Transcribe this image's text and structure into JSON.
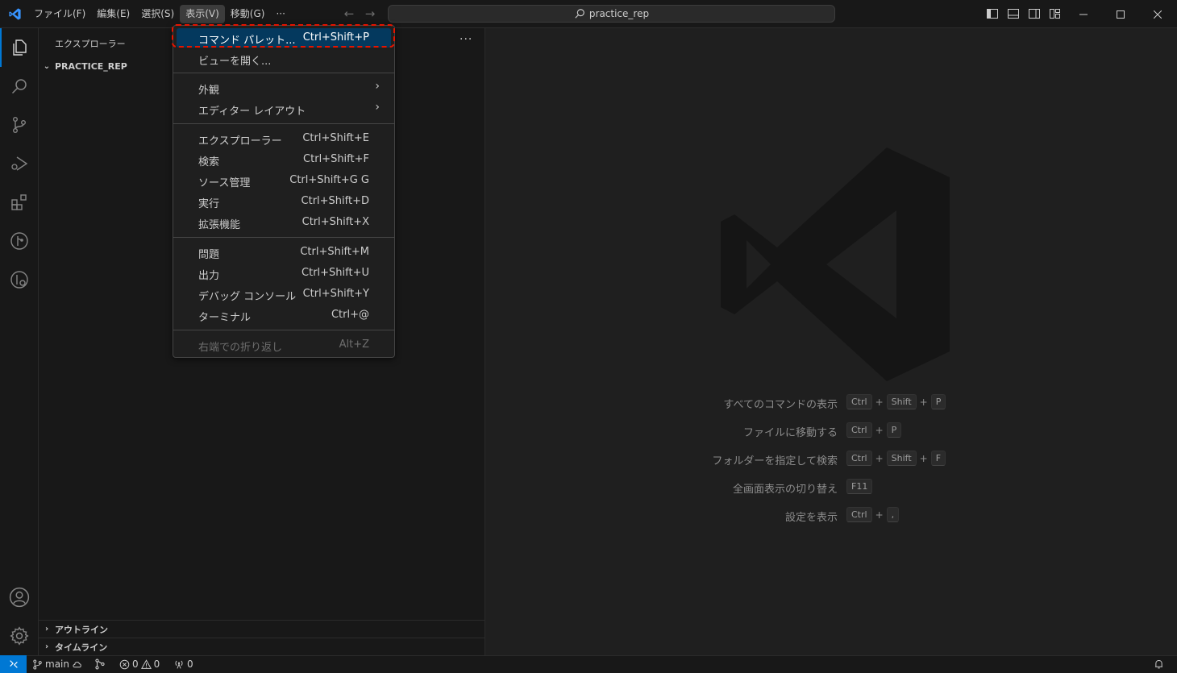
{
  "titlebar": {
    "menus": [
      "ファイル(F)",
      "編集(E)",
      "選択(S)",
      "表示(V)",
      "移動(G)",
      "···"
    ],
    "search_text": "practice_rep"
  },
  "sidebar": {
    "title": "エクスプローラー",
    "more": "···",
    "folder": "PRACTICE_REP",
    "outline": "アウトライン",
    "timeline": "タイムライン"
  },
  "dropdown": {
    "items": [
      {
        "label": "コマンド パレット...",
        "key": "Ctrl+Shift+P"
      },
      {
        "label": "ビューを開く...",
        "key": ""
      },
      {
        "label": "外観",
        "key": ""
      },
      {
        "label": "エディター レイアウト",
        "key": ""
      },
      {
        "label": "エクスプローラー",
        "key": "Ctrl+Shift+E"
      },
      {
        "label": "検索",
        "key": "Ctrl+Shift+F"
      },
      {
        "label": "ソース管理",
        "key": "Ctrl+Shift+G G"
      },
      {
        "label": "実行",
        "key": "Ctrl+Shift+D"
      },
      {
        "label": "拡張機能",
        "key": "Ctrl+Shift+X"
      },
      {
        "label": "問題",
        "key": "Ctrl+Shift+M"
      },
      {
        "label": "出力",
        "key": "Ctrl+Shift+U"
      },
      {
        "label": "デバッグ コンソール",
        "key": "Ctrl+Shift+Y"
      },
      {
        "label": "ターミナル",
        "key": "Ctrl+@"
      },
      {
        "label": "右端での折り返し",
        "key": "Alt+Z"
      }
    ],
    "submenu_arrow": "›"
  },
  "editor": {
    "shortcuts": [
      {
        "label": "すべてのコマンドの表示",
        "keys": [
          "Ctrl",
          "Shift",
          "P"
        ]
      },
      {
        "label": "ファイルに移動する",
        "keys": [
          "Ctrl",
          "P"
        ]
      },
      {
        "label": "フォルダーを指定して検索",
        "keys": [
          "Ctrl",
          "Shift",
          "F"
        ]
      },
      {
        "label": "全画面表示の切り替え",
        "keys": [
          "F11"
        ]
      },
      {
        "label": "設定を表示",
        "keys": [
          "Ctrl",
          ","
        ]
      }
    ],
    "plus": "+"
  },
  "statusbar": {
    "branch": "main",
    "errors": "0",
    "warnings": "0",
    "ports": "0"
  },
  "colors": {
    "accent": "#0078d4",
    "selection": "#04395e",
    "highlight_border": "#e51400"
  }
}
